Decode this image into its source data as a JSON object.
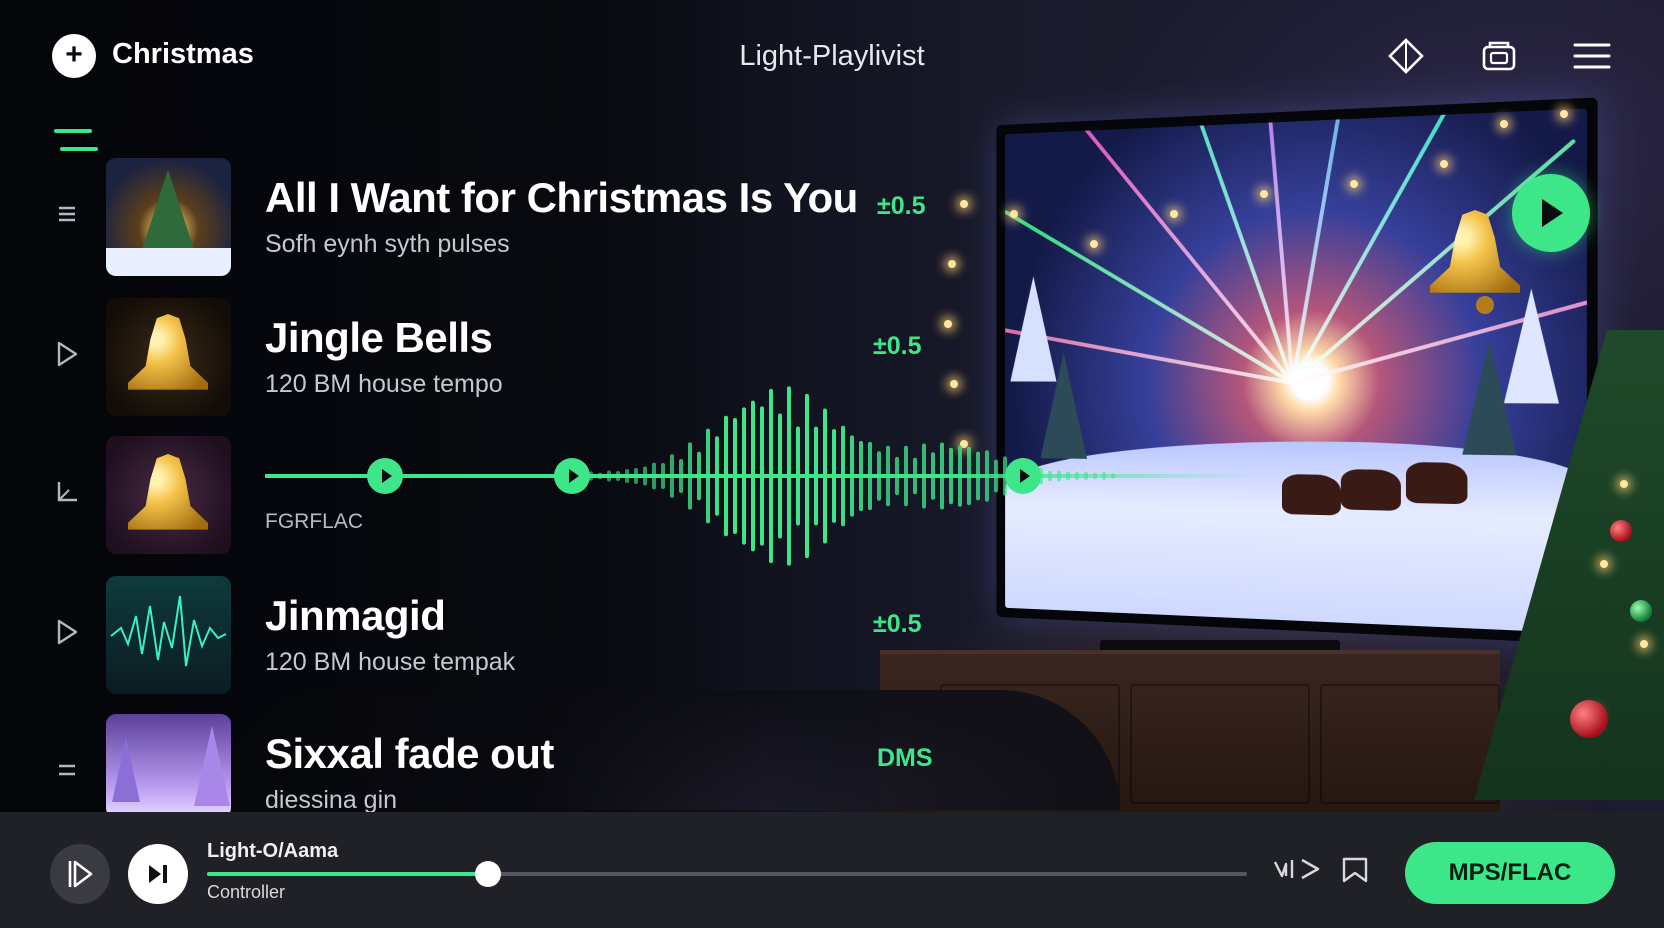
{
  "header": {
    "brand": "Christmas",
    "title": "Light-Playlivist",
    "icons": [
      "diamond-icon",
      "window-icon",
      "menu-icon"
    ]
  },
  "tracks": [
    {
      "control": "drag-handle-icon",
      "title": "All I Want for Christmas Is You",
      "subtitle": "Sofh eynh syth pulses",
      "value": "±0.5"
    },
    {
      "control": "play-icon",
      "title": "Jingle Bells",
      "subtitle": "120 BM house tempo",
      "value": "±0.5"
    },
    {
      "control": "corner-icon",
      "title": "",
      "subtitle": "",
      "format": "FGRFLAC"
    },
    {
      "control": "play-icon",
      "title": "Jinmagid",
      "subtitle": "120 BM house tempak",
      "value": "±0.5"
    },
    {
      "control": "drag-handle-icon",
      "title": "Sixxal fade out",
      "subtitle": "diessina gin",
      "value": "DMS"
    }
  ],
  "player": {
    "title": "Light-O/Aama",
    "subtitle": "Controller",
    "progress": 0.27,
    "format_button": "MPS/FLAC",
    "icons": [
      "skip-back-icon",
      "play-pause-icon",
      "repeat-icon",
      "bookmark-icon"
    ]
  },
  "colors": {
    "accent": "#3ee68a",
    "bar": "#202126",
    "background": "#0a0b12"
  }
}
